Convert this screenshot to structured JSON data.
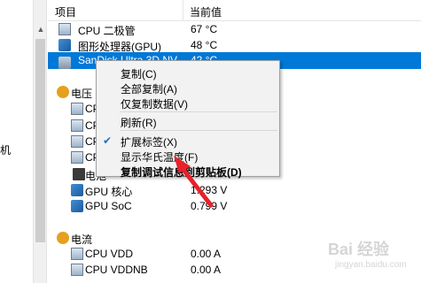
{
  "left_pane": {
    "partial_text": "机"
  },
  "header": {
    "col_item": "项目",
    "col_value": "当前值"
  },
  "rows": [
    {
      "name": "CPU 二极管",
      "value": "67 °C",
      "icon": "chip-icon"
    },
    {
      "name": "图形处理器(GPU)",
      "value": "48 °C",
      "icon": "gpu-icon"
    },
    {
      "name": "SanDisk Ultra 3D NV...",
      "value": "42 °C",
      "icon": "disk-icon"
    },
    {
      "name": "电压",
      "value": "",
      "icon": "voltage-group-icon"
    },
    {
      "name": "CPU",
      "value": "",
      "icon": "chip-icon"
    },
    {
      "name": "CPU",
      "value": "",
      "icon": "chip-icon"
    },
    {
      "name": "CPU",
      "value": "",
      "icon": "chip-icon"
    },
    {
      "name": "CPU",
      "value": "",
      "icon": "chip-icon"
    },
    {
      "name": "电池",
      "value": "",
      "icon": "battery-icon"
    },
    {
      "name": "GPU 核心",
      "value": "1.293 V",
      "icon": "gpu-icon"
    },
    {
      "name": "GPU SoC",
      "value": "0.799 V",
      "icon": "gpu-icon"
    },
    {
      "name": "电流",
      "value": "",
      "icon": "current-group-icon"
    },
    {
      "name": "CPU VDD",
      "value": "0.00 A",
      "icon": "chip-icon"
    },
    {
      "name": "CPU VDDNB",
      "value": "0.00 A",
      "icon": "chip-icon"
    }
  ],
  "context_menu": {
    "items": [
      "复制(C)",
      "全部复制(A)",
      "仅复制数据(V)",
      "刷新(R)",
      "扩展标签(X)",
      "显示华氏温度(F)",
      "复制调试信息到剪贴板(D)"
    ],
    "checked": "✔"
  },
  "watermark": {
    "line1": "Bai 经验",
    "line2": "jingyan.baidu.com"
  },
  "colors": {
    "selection": "#0078d7",
    "annotation_arrow": "#e8212c"
  }
}
